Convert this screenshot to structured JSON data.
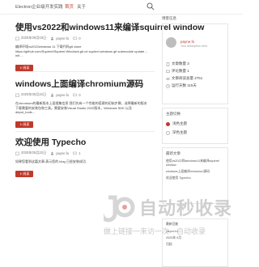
{
  "header": {
    "site_title": "Electron企业级开发实践",
    "nav": [
      "首页",
      "关于"
    ]
  },
  "posts": [
    {
      "title": "使用vs2022和windows11来编译squirrel window",
      "date": "2025年09月03日",
      "author": "payne.fu",
      "comments": "0",
      "excerpt": "编译环境vs2022windows 11 下载代码git clone https://github.com/Squirrel/Squirrel.Windows.git cd squirrel.windows git submodule update --init ...",
      "read_more": "阅读"
    },
    {
      "title": "windows上面编译chromium源码",
      "date": "2025年05月22日",
      "author": "payne.fu",
      "comments": "0",
      "excerpt": "在chromium的最新版本上面搜集信息 我们先有一个性能的搭建的初始步骤，选择最新的版本下载需要的安装包和工具。需要安装Visual Studio 2022版本，Windows SDK 以及 depot_tools...",
      "read_more": "阅读"
    },
    {
      "title": "欢迎使用 Typecho",
      "date": "2025年05月22日",
      "author": "payne.fu",
      "comments": "1",
      "excerpt": "如果您看到这篇文章,表示您的 blog 已经安装成功.",
      "read_more": "阅读"
    }
  ],
  "sidebar": {
    "author_heading": "博客信息",
    "author_name": "payne.fu",
    "author_desc": "Your description here.",
    "stats": [
      "文章数量 3",
      "评论数量 1",
      "文章阅读总量 2751",
      "运行天数 115天"
    ],
    "theme_heading": "主题切换",
    "theme_options": [
      "浅色主题",
      "深色主题"
    ],
    "theme_selected": 0,
    "recent_heading": "最新文章",
    "recent_posts": [
      "使用vs2022和windows11来编译squirrel window",
      "windows上面编译chromium源码",
      "欢迎使用 Typecho"
    ],
    "lower_heading": "最新回复",
    "lower_items": [
      "payne.fu",
      "2025年 5月",
      "归档"
    ]
  },
  "watermark": {
    "brand": "自动秒收录",
    "subtitle": "做上链接一来访一次一自动收录"
  }
}
